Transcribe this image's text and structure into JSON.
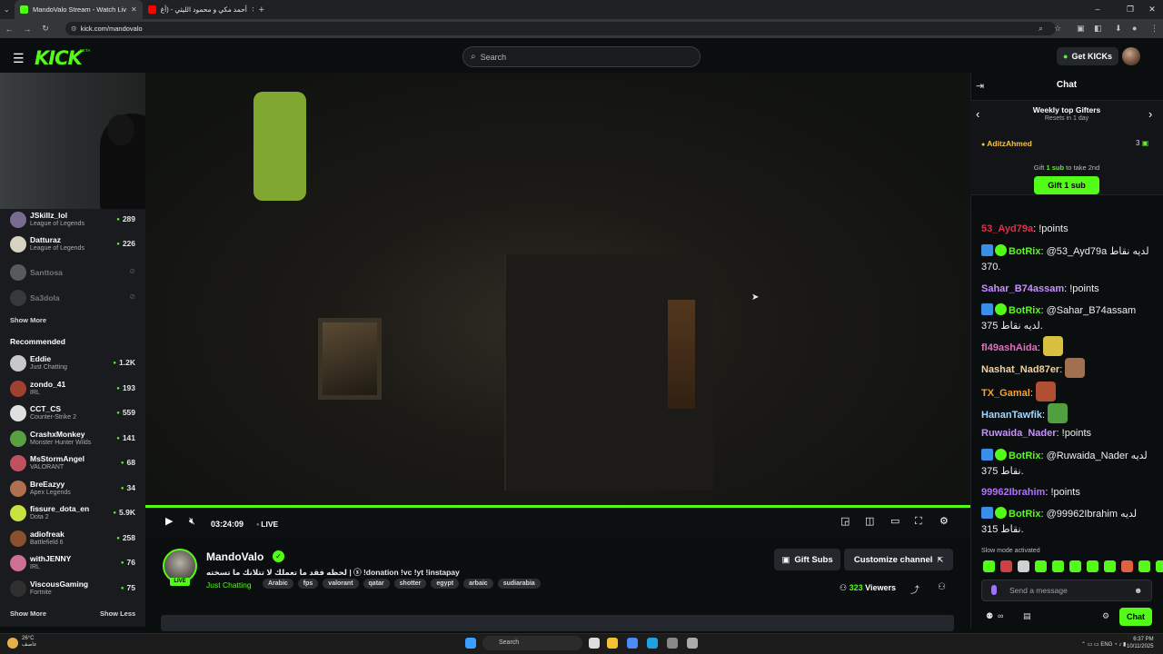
{
  "browser": {
    "tabs": [
      {
        "title": "MandoValo Stream - Watch Liv",
        "active": true,
        "favicon_color": "#53fc18"
      },
      {
        "title": "أحمد مكي و محمود الليثي - (أغ",
        "active": false,
        "favicon_color": "#ff0000"
      }
    ],
    "url": "kick.com/mandovalo"
  },
  "header": {
    "logo": "KICK",
    "logo_badge": "BETA",
    "search_placeholder": "Search",
    "get_kicks_label": "Get KICKs"
  },
  "sidebar": {
    "following": [
      {
        "name": "JSkillz_lol",
        "category": "League of Legends",
        "viewers": "289",
        "live": true,
        "avatar_color": "#7a6b8e"
      },
      {
        "name": "Datturaz",
        "category": "League of Legends",
        "viewers": "226",
        "live": true,
        "avatar_color": "#d9d2c0"
      },
      {
        "name": "Santtosa",
        "category": "",
        "viewers": "",
        "live": false,
        "avatar_color": "#9a9a9a"
      },
      {
        "name": "Sa3dola",
        "category": "",
        "viewers": "",
        "live": false,
        "avatar_color": "#555"
      }
    ],
    "show_more_label": "Show More",
    "recommended_label": "Recommended",
    "recommended": [
      {
        "name": "Eddie",
        "category": "Just Chatting",
        "viewers": "1.2K",
        "avatar_color": "#c8c8c8"
      },
      {
        "name": "zondo_41",
        "category": "IRL",
        "viewers": "193",
        "avatar_color": "#a04030"
      },
      {
        "name": "CCT_CS",
        "category": "Counter-Strike 2",
        "viewers": "559",
        "avatar_color": "#e0e0e0"
      },
      {
        "name": "CrashxMonkey",
        "category": "Monster Hunter Wilds",
        "viewers": "141",
        "avatar_color": "#5aa040"
      },
      {
        "name": "MsStormAngel",
        "category": "VALORANT",
        "viewers": "68",
        "avatar_color": "#c05060"
      },
      {
        "name": "BreEazyy",
        "category": "Apex Legends",
        "viewers": "34",
        "avatar_color": "#b07050"
      },
      {
        "name": "fissure_dota_en",
        "category": "Dota 2",
        "viewers": "5.9K",
        "avatar_color": "#c8e040"
      },
      {
        "name": "adiofreak",
        "category": "Battlefield 6",
        "viewers": "258",
        "avatar_color": "#8a5030"
      },
      {
        "name": "withJENNY",
        "category": "IRL",
        "viewers": "76",
        "avatar_color": "#d07090"
      },
      {
        "name": "ViscousGaming",
        "category": "Fortnite",
        "viewers": "75",
        "avatar_color": "#303030"
      }
    ],
    "show_more_bottom": "Show More",
    "show_less_label": "Show Less"
  },
  "player": {
    "time": "03:24:09",
    "live_label": "LIVE",
    "progress_fraction": 1.0
  },
  "stream": {
    "channel_name": "MandoValo",
    "live_badge": "LIVE",
    "title": "لحظه فقد ما تعملك لا تتلانك ما تسخته | ⓢ !donation !vc !yt !instapay",
    "category": "Just Chatting",
    "tags": [
      "Arabic",
      "fps",
      "valorant",
      "qatar",
      "shotter",
      "egypt",
      "arbaic",
      "sudiarabia"
    ],
    "gift_subs_label": "Gift Subs",
    "customize_label": "Customize channel",
    "viewers_count": "323",
    "viewers_label": "Viewers"
  },
  "chat": {
    "title": "Chat",
    "gifters_title": "Weekly top Gifters",
    "gifters_reset": "Resets in 1 day",
    "top_gifter": "AditzAhmed",
    "top_gifter_count": "3",
    "gift_prompt_pre": "Gift",
    "gift_prompt_sub": "1 sub",
    "gift_prompt_post": "to take 2nd",
    "gift_button": "Gift 1 sub",
    "messages": [
      {
        "user": "53_Ayd79a",
        "color": "#e0304a",
        "text": ": !points",
        "bot": false
      },
      {
        "user": "BotRix",
        "color": "#53fc18",
        "text": ": @53_Ayd79a لديه نقاط 370.",
        "bot": true
      },
      {
        "user": "Sahar_B74assam",
        "color": "#c890ff",
        "text": ": !points",
        "bot": false
      },
      {
        "user": "BotRix",
        "color": "#53fc18",
        "text": ": @Sahar_B74assam لديه نقاط 375.",
        "bot": true
      },
      {
        "user": "fl49ashAida",
        "color": "#e070c0",
        "text": ":",
        "bot": false,
        "emote": "#d8c040"
      },
      {
        "user": "Nashat_Nad87er",
        "color": "#f2d0a0",
        "text": ":",
        "bot": false,
        "emote": "#a07050"
      },
      {
        "user": "TX_Gamal",
        "color": "#ffa020",
        "text": ":",
        "bot": false,
        "emote": "#b05030"
      },
      {
        "user": "HananTawfik",
        "color": "#a0d8ff",
        "text": ":",
        "bot": false,
        "emote": "#50a040"
      },
      {
        "user": "Ruwaida_Nader",
        "color": "#c890ff",
        "text": ": !points",
        "bot": false
      },
      {
        "user": "BotRix",
        "color": "#53fc18",
        "text": ": @Ruwaida_Nader لديه نقاط 375.",
        "bot": true
      },
      {
        "user": "99962Ibrahim",
        "color": "#b070ff",
        "text": ": !points",
        "bot": false
      },
      {
        "user": "BotRix",
        "color": "#53fc18",
        "text": ": @99962Ibrahim لديه نقاط 315.",
        "bot": true
      }
    ],
    "slow_mode": "Slow mode activated",
    "input_placeholder": "Send a message",
    "send_button": "Chat"
  },
  "taskbar": {
    "weather_temp": "26°C",
    "weather_desc": "عاصف",
    "search_label": "Search",
    "lang": "ENG",
    "time": "6:37 PM",
    "date": "10/11/2025"
  }
}
